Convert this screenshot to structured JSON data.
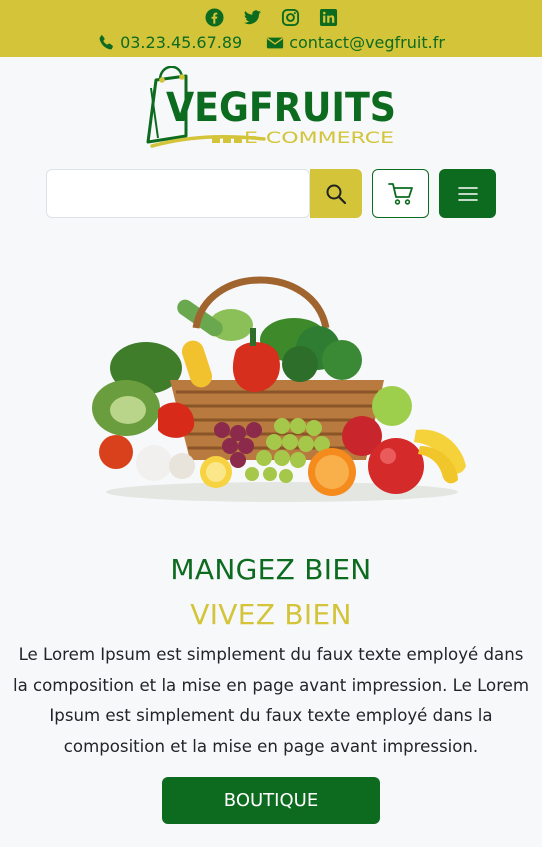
{
  "topbar": {
    "social": [
      {
        "icon": "facebook-icon"
      },
      {
        "icon": "twitter-icon"
      },
      {
        "icon": "instagram-icon"
      },
      {
        "icon": "linkedin-icon"
      }
    ],
    "phone": "03.23.45.67.89",
    "email": "contact@vegfruit.fr"
  },
  "logo": {
    "name": "VEGFRUITS",
    "tagline": "E-COMMERCE"
  },
  "search": {
    "value": "",
    "placeholder": ""
  },
  "hero": {
    "image": "vegetable-basket"
  },
  "headline": {
    "line1": "MANGEZ BIEN",
    "line2": "VIVEZ BIEN"
  },
  "description": "Le Lorem Ipsum est simplement du faux texte employé dans la composition et la mise en page avant impression. Le Lorem Ipsum est simplement du faux texte employé dans la composition et la mise en page avant impression.",
  "cta": {
    "label": "BOUTIQUE"
  },
  "colors": {
    "brand_green": "#0d6b1f",
    "brand_yellow": "#d3c43a",
    "background": "#f7f8fa"
  }
}
